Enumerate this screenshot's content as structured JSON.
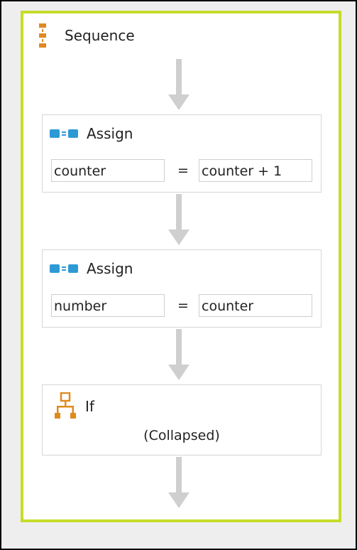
{
  "sequence": {
    "title": "Sequence",
    "icon": "sequence-icon",
    "border_color": "#c6dc2a"
  },
  "activities": [
    {
      "type": "Assign",
      "title": "Assign",
      "icon": "assign-icon",
      "to_value": "counter",
      "equals": "=",
      "value": "counter + 1"
    },
    {
      "type": "Assign",
      "title": "Assign",
      "icon": "assign-icon",
      "to_value": "number",
      "equals": "=",
      "value": "counter"
    },
    {
      "type": "If",
      "title": "If",
      "icon": "flowchart-icon",
      "state": "(Collapsed)"
    }
  ],
  "colors": {
    "assign_icon": "#2d9ad6",
    "sequence_icon": "#e08a1e",
    "arrow": "#cfcfcf",
    "card_border": "#d6d6d6"
  }
}
